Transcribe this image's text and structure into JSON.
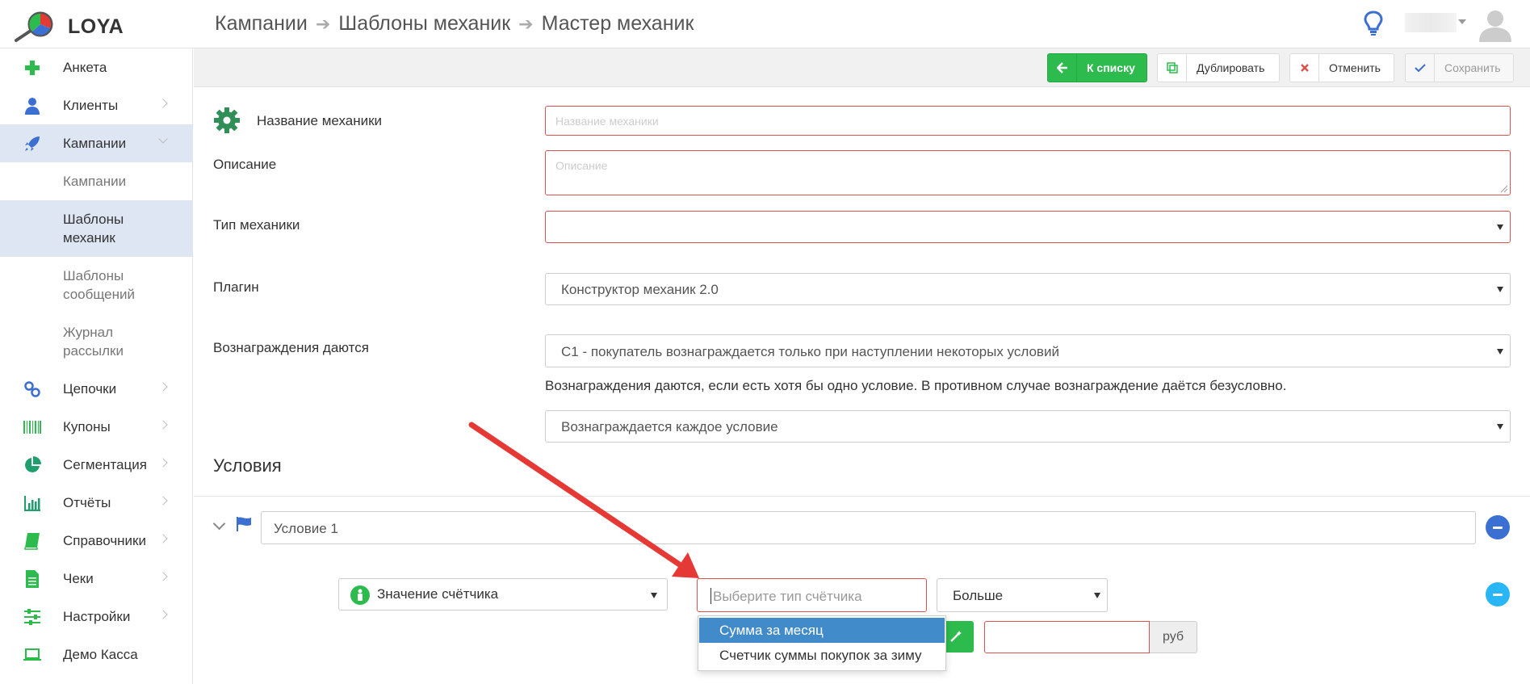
{
  "app": {
    "name": "LOYA"
  },
  "breadcrumb": [
    "Кампании",
    "Шаблоны механик",
    "Мастер механик"
  ],
  "sidebar": {
    "items": [
      {
        "label": "Анкета",
        "icon": "plus-icon"
      },
      {
        "label": "Клиенты",
        "icon": "user-icon"
      },
      {
        "label": "Кампании",
        "icon": "rocket-icon"
      },
      {
        "label": "Цепочки",
        "icon": "link-icon"
      },
      {
        "label": "Купоны",
        "icon": "barcode-icon"
      },
      {
        "label": "Сегментация",
        "icon": "pie-chart-icon"
      },
      {
        "label": "Отчёты",
        "icon": "bar-chart-icon"
      },
      {
        "label": "Справочники",
        "icon": "book-icon"
      },
      {
        "label": "Чеки",
        "icon": "document-icon"
      },
      {
        "label": "Настройки",
        "icon": "sliders-icon"
      },
      {
        "label": "Демо Касса",
        "icon": "laptop-icon"
      }
    ],
    "subitems": [
      {
        "label": "Кампании"
      },
      {
        "label": "Шаблоны механик"
      },
      {
        "label": "Шаблоны сообщений"
      },
      {
        "label": "Журнал рассылки"
      }
    ]
  },
  "toolbar": {
    "back_label": "К списку",
    "duplicate_label": "Дублировать",
    "cancel_label": "Отменить",
    "save_label": "Сохранить"
  },
  "form": {
    "name_label": "Название механики",
    "name_placeholder": "Название механики",
    "description_label": "Описание",
    "description_placeholder": "Описание",
    "type_label": "Тип механики",
    "type_value": "",
    "plugin_label": "Плагин",
    "plugin_value": "Конструктор механик 2.0",
    "rewards_label": "Вознаграждения даются",
    "rewards_value": "C1 - покупатель вознаграждается только при наступлении некоторых условий",
    "rewards_hint": "Вознаграждения даются, если есть хотя бы одно условие. В противном случае вознаграждение даётся безусловно.",
    "rewards_mode_value": "Вознаграждается каждое условие"
  },
  "conditions": {
    "title": "Условия",
    "condition_name": "Условие 1",
    "counter_select_value": "Значение счётчика",
    "counter_type_placeholder": "Выберите тип счётчика",
    "comparison_value": "Больше",
    "amount_value": "",
    "amount_unit": "руб",
    "dropdown_options": [
      "Сумма за месяц",
      "Счетчик суммы покупок за зиму"
    ]
  },
  "colors": {
    "accent_green": "#2dbb4e",
    "error_red": "#d9534f",
    "selected_blue": "#428bca",
    "active_nav_bg": "#dfe6f3",
    "annotation_arrow": "#e53935"
  }
}
